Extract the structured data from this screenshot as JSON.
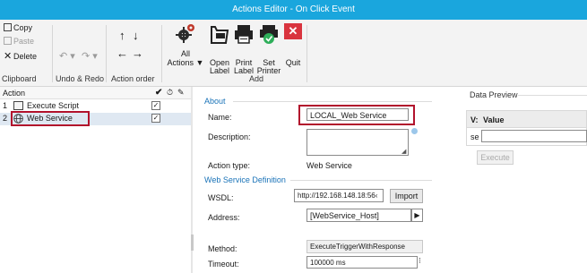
{
  "window": {
    "title": "Actions Editor - On Click Event"
  },
  "ribbon": {
    "clipboard": {
      "copy": "Copy",
      "paste": "Paste",
      "delete": "Delete",
      "group": "Clipboard"
    },
    "undo_redo": {
      "group": "Undo & Redo"
    },
    "action_order": {
      "group": "Action order"
    },
    "all_actions": {
      "line1": "All",
      "line2": "Actions ▼"
    },
    "add": {
      "group": "Add",
      "open_label": [
        "Open",
        "Label"
      ],
      "print_label": [
        "Print",
        "Label"
      ],
      "set_printer": [
        "Set",
        "Printer"
      ],
      "quit": "Quit"
    }
  },
  "action_list": {
    "header": "Action",
    "header_icons": [
      "✔",
      "⏱",
      "✎"
    ],
    "rows": [
      {
        "index": "1",
        "label": "Execute Script",
        "checked": "✓"
      },
      {
        "index": "2",
        "label": "Web Service",
        "checked": "✓"
      }
    ]
  },
  "form": {
    "about": {
      "section": "About",
      "name_label": "Name:",
      "name_value": "LOCAL_Web Service",
      "description_label": "Description:",
      "action_type_label": "Action type:",
      "action_type_value": "Web Service"
    },
    "ws": {
      "section": "Web Service Definition",
      "wsdl_label": "WSDL:",
      "wsdl_value": "http://192.168.148.18:56‹",
      "import": "Import",
      "address_label": "Address:",
      "address_value": "[WebService_Host]",
      "method_label": "Method:",
      "method_value": "ExecuteTriggerWithResponse",
      "timeout_label": "Timeout:",
      "timeout_value": "100000 ms"
    }
  },
  "data_preview": {
    "title": "Data Preview",
    "col1": "V:",
    "col2": "Value",
    "row_label": "se",
    "execute": "Execute"
  },
  "colors": {
    "titlebar": "#1aa6dd",
    "highlight": "#b2122c",
    "section": "#1a73b8"
  }
}
